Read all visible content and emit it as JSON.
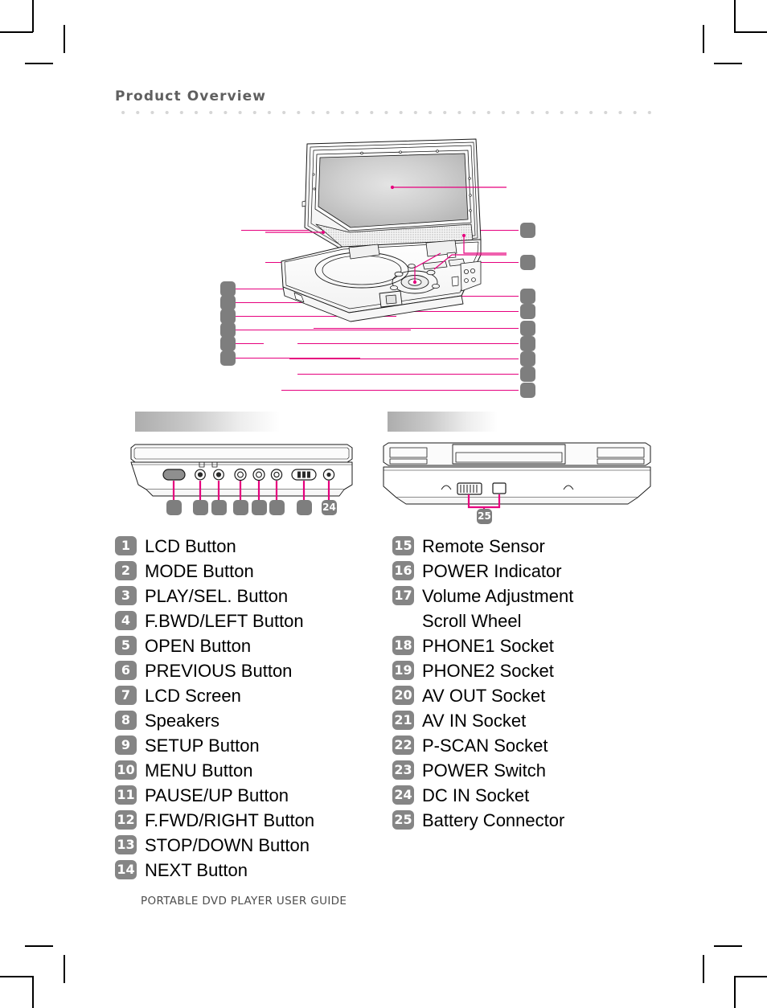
{
  "header": {
    "title": "Product Overview"
  },
  "footer": {
    "text": "PORTABLE DVD PLAYER USER GUIDE"
  },
  "colors": {
    "leader_line": "#e6007e",
    "badge_gray": "#858585",
    "callout_gray": "#7e7e7e",
    "title_gray": "#5f5f5f",
    "dot_gray": "#d6d6d6"
  },
  "figures": {
    "main": {
      "name": "open-player-front-view",
      "callouts_left": [
        "",
        "",
        "",
        "",
        "",
        ""
      ],
      "callouts_right": [
        "",
        "",
        "",
        "",
        "",
        "",
        "",
        "",
        ""
      ]
    },
    "side_left": {
      "name": "right-side-panel-view",
      "callouts": [
        "",
        "",
        "",
        "",
        "",
        "",
        "",
        "24"
      ]
    },
    "side_right": {
      "name": "rear-bottom-panel-view",
      "callouts": [
        "25"
      ]
    }
  },
  "legend": {
    "left": [
      {
        "num": "1",
        "label": "LCD Button"
      },
      {
        "num": "2",
        "label": "MODE Button"
      },
      {
        "num": "3",
        "label": "PLAY/SEL. Button"
      },
      {
        "num": "4",
        "label": "F.BWD/LEFT Button"
      },
      {
        "num": "5",
        "label": "OPEN Button"
      },
      {
        "num": "6",
        "label": "PREVIOUS Button"
      },
      {
        "num": "7",
        "label": "LCD Screen"
      },
      {
        "num": "8",
        "label": "Speakers"
      },
      {
        "num": "9",
        "label": "SETUP Button"
      },
      {
        "num": "10",
        "label": "MENU Button"
      },
      {
        "num": "11",
        "label": "PAUSE/UP Button"
      },
      {
        "num": "12",
        "label": "F.FWD/RIGHT Button"
      },
      {
        "num": "13",
        "label": "STOP/DOWN Button"
      },
      {
        "num": "14",
        "label": "NEXT Button"
      }
    ],
    "right": [
      {
        "num": "15",
        "label": "Remote Sensor"
      },
      {
        "num": "16",
        "label": "POWER Indicator"
      },
      {
        "num": "17",
        "label": "Volume Adjustment",
        "label2": "Scroll Wheel"
      },
      {
        "num": "18",
        "label": "PHONE1 Socket"
      },
      {
        "num": "19",
        "label": "PHONE2 Socket"
      },
      {
        "num": "20",
        "label": "AV OUT Socket"
      },
      {
        "num": "21",
        "label": "AV IN Socket"
      },
      {
        "num": "22",
        "label": "P-SCAN Socket"
      },
      {
        "num": "23",
        "label": "POWER Switch"
      },
      {
        "num": "24",
        "label": "DC IN Socket"
      },
      {
        "num": "25",
        "label": "Battery Connector"
      }
    ]
  }
}
